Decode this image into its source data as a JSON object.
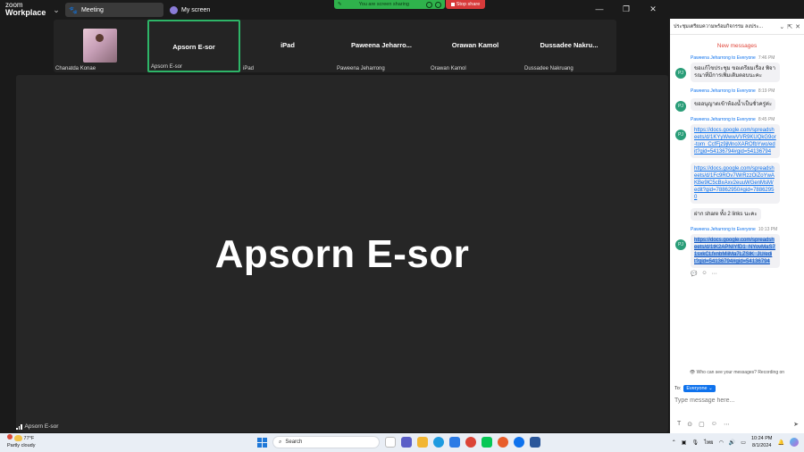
{
  "app": {
    "logo_line1": "zoom",
    "logo_line2": "Workplace"
  },
  "tabs": [
    {
      "label": "Meeting"
    },
    {
      "label": "My screen"
    }
  ],
  "sharing": {
    "status": "You are screen sharing",
    "stop_label": "Stop share"
  },
  "participants": [
    {
      "name": "Chanatda Konae",
      "has_photo": true
    },
    {
      "name": "Apsorn E-sor",
      "display": "Apsorn E-sor",
      "active": true
    },
    {
      "name": "iPad",
      "display": "iPad"
    },
    {
      "name": "Paweena Jeharrong",
      "display": "Paweena  Jeharro..."
    },
    {
      "name": "Orawan Kamol",
      "display": "Orawan Kamol"
    },
    {
      "name": "Dussadee Nakruang",
      "display": "Dussadee  Nakru..."
    }
  ],
  "stage": {
    "speaker": "Apsorn E-sor",
    "label": "Apsorn E-sor"
  },
  "chat": {
    "title": "ประชุมเตรียมความพร้อมกิจกรรม ลงประ...",
    "new_messages": "New messages",
    "messages": [
      {
        "from": "Paweena Jeharrong",
        "to": "Everyone",
        "time": "7:46 PM",
        "text": "ขอแก้ไขประชุม ขอเตรียมเรื่อง พิจารณาที่มีการเพิ่มเติมตอบนะคะ",
        "type": "text"
      },
      {
        "from": "Paweena Jeharrong",
        "to": "Everyone",
        "time": "8:19 PM",
        "text": "ขออนุญาตเข้าห้องน้ำเป็นชั่วครู่ค่ะ",
        "type": "text"
      },
      {
        "from": "Paweena Jeharrong",
        "to": "Everyone",
        "time": "8:45 PM",
        "text": "https://docs.google.com/spreadsheets/d/1KYyWwwVVR9KUQkG9or-tom_CcfFjz9jMnoXAROfbYwo/edit?gid=54136794#gid=54136794",
        "type": "link"
      },
      {
        "text": "https://docs.google.com/spreadsheets/d/1Fc9ROv7WrRzzOiZoYwAKBe9lC5cBxAxv2euuWGenMsM/edit?gid=78862950#gid=78862950",
        "type": "link"
      },
      {
        "text": "ฝาก share ทั้ง 2 links นะคะ",
        "type": "text"
      },
      {
        "from": "Paweena Jeharrong",
        "to": "Everyone",
        "time": "10:13 PM",
        "text": "https://docs.google.com/spreadsheets/d/1tK2APNIYfD1_NYovMaS71sxkCLfxnbMiiMa7LZSlK_JU/edit?gid=54136794#gid=54136794",
        "type": "selected"
      }
    ],
    "who_can_see": "Who can see your messages? Recording on",
    "to_label": "To:",
    "recipient": "Everyone",
    "input_placeholder": "Type message here..."
  },
  "taskbar": {
    "temp": "77°F",
    "weather": "Partly cloudy",
    "search_placeholder": "Search",
    "lang": "ไทย",
    "time": "10:24 PM",
    "date": "8/1/2024"
  }
}
